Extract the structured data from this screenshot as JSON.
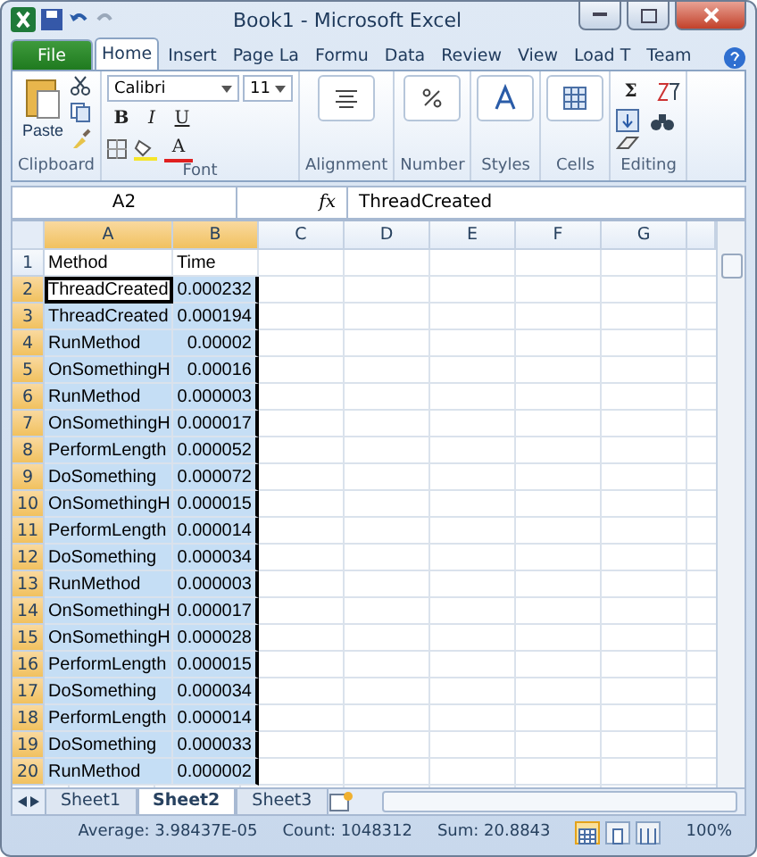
{
  "window": {
    "title": "Book1  -  Microsoft Excel"
  },
  "tabs": [
    {
      "label": "File",
      "kind": "file",
      "selected": false
    },
    {
      "label": "Home",
      "kind": "tab",
      "selected": true
    },
    {
      "label": "Insert",
      "kind": "tab",
      "selected": false
    },
    {
      "label": "Page La",
      "kind": "tab",
      "selected": false
    },
    {
      "label": "Formu",
      "kind": "tab",
      "selected": false
    },
    {
      "label": "Data",
      "kind": "tab",
      "selected": false
    },
    {
      "label": "Review",
      "kind": "tab",
      "selected": false
    },
    {
      "label": "View",
      "kind": "tab",
      "selected": false
    },
    {
      "label": "Load T",
      "kind": "tab",
      "selected": false
    },
    {
      "label": "Team",
      "kind": "tab",
      "selected": false
    }
  ],
  "ribbon": {
    "paste_label": "Paste",
    "font_name": "Calibri",
    "font_size": "11",
    "font_buttons": [
      "B",
      "I",
      "U"
    ],
    "font_color_glyph": "A",
    "sum_glyph": "Σ",
    "groups": [
      {
        "label": "Clipboard",
        "kind": "clipboard"
      },
      {
        "label": "Font",
        "kind": "font"
      },
      {
        "label": "Alignment",
        "kind": "alignment"
      },
      {
        "label": "Number",
        "kind": "number"
      },
      {
        "label": "Styles",
        "kind": "styles"
      },
      {
        "label": "Cells",
        "kind": "cells"
      },
      {
        "label": "Editing",
        "kind": "editing"
      }
    ]
  },
  "formula_bar": {
    "name_box": "A2",
    "fx": "fx",
    "value": "ThreadCreated"
  },
  "columns": [
    {
      "label": "A",
      "selected": true
    },
    {
      "label": "B",
      "selected": true
    },
    {
      "label": "C",
      "selected": false
    },
    {
      "label": "D",
      "selected": false
    },
    {
      "label": "E",
      "selected": false
    },
    {
      "label": "F",
      "selected": false
    },
    {
      "label": "G",
      "selected": false
    }
  ],
  "rows": [
    {
      "number": "1",
      "selected": false,
      "active": false,
      "method": "Method",
      "time": "Time"
    },
    {
      "number": "2",
      "selected": true,
      "active": true,
      "method": "ThreadCreated",
      "time": "0.000232"
    },
    {
      "number": "3",
      "selected": true,
      "active": false,
      "method": "ThreadCreated",
      "time": "0.000194"
    },
    {
      "number": "4",
      "selected": true,
      "active": false,
      "method": "RunMethod",
      "time": "0.00002"
    },
    {
      "number": "5",
      "selected": true,
      "active": false,
      "method": "OnSomethingH",
      "time": "0.00016"
    },
    {
      "number": "6",
      "selected": true,
      "active": false,
      "method": "RunMethod",
      "time": "0.000003"
    },
    {
      "number": "7",
      "selected": true,
      "active": false,
      "method": "OnSomethingH",
      "time": "0.000017"
    },
    {
      "number": "8",
      "selected": true,
      "active": false,
      "method": "PerformLength",
      "time": "0.000052"
    },
    {
      "number": "9",
      "selected": true,
      "active": false,
      "method": "DoSomething",
      "time": "0.000072"
    },
    {
      "number": "10",
      "selected": true,
      "active": false,
      "method": "OnSomethingH",
      "time": "0.000015"
    },
    {
      "number": "11",
      "selected": true,
      "active": false,
      "method": "PerformLength",
      "time": "0.000014"
    },
    {
      "number": "12",
      "selected": true,
      "active": false,
      "method": "DoSomething",
      "time": "0.000034"
    },
    {
      "number": "13",
      "selected": true,
      "active": false,
      "method": "RunMethod",
      "time": "0.000003"
    },
    {
      "number": "14",
      "selected": true,
      "active": false,
      "method": "OnSomethingH",
      "time": "0.000017"
    },
    {
      "number": "15",
      "selected": true,
      "active": false,
      "method": "OnSomethingH",
      "time": "0.000028"
    },
    {
      "number": "16",
      "selected": true,
      "active": false,
      "method": "PerformLength",
      "time": "0.000015"
    },
    {
      "number": "17",
      "selected": true,
      "active": false,
      "method": "DoSomething",
      "time": "0.000034"
    },
    {
      "number": "18",
      "selected": true,
      "active": false,
      "method": "PerformLength",
      "time": "0.000014"
    },
    {
      "number": "19",
      "selected": true,
      "active": false,
      "method": "DoSomething",
      "time": "0.000033"
    },
    {
      "number": "20",
      "selected": true,
      "active": false,
      "method": "RunMethod",
      "time": "0.000002"
    }
  ],
  "sheets": [
    {
      "label": "Sheet1",
      "selected": false
    },
    {
      "label": "Sheet2",
      "selected": true
    },
    {
      "label": "Sheet3",
      "selected": false
    }
  ],
  "status_bar": {
    "average": "Average: 3.98437E-05",
    "count": "Count: 1048312",
    "sum": "Sum: 20.8843",
    "zoom": "100%",
    "views": [
      {
        "kind": "normal",
        "selected": true
      },
      {
        "kind": "layout",
        "selected": false
      },
      {
        "kind": "preview",
        "selected": false
      }
    ]
  }
}
